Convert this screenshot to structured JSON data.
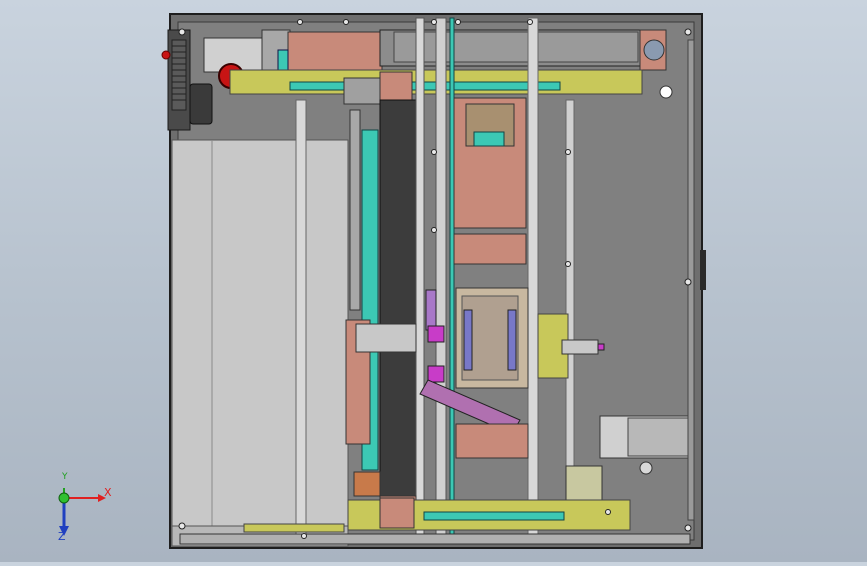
{
  "viewport": {
    "background": [
      "#c9d3de",
      "#a9b4c1"
    ]
  },
  "model": {
    "colors": {
      "frame": "#6b6b6b",
      "frame_dark": "#2a2a2a",
      "panel_gray": "#c8c8c8",
      "copper": "#c88a7a",
      "yellow": "#c8c85a",
      "cyan": "#3cc8b4",
      "magenta": "#c83cc8",
      "red": "#c81414",
      "purple": "#7878c8",
      "steel": "#d8d8d8"
    }
  },
  "triad": {
    "x_label": "X",
    "y_label": "Y",
    "z_label": "Z",
    "x_color": "#e02020",
    "y_color": "#20a020",
    "z_color": "#2040c0"
  }
}
